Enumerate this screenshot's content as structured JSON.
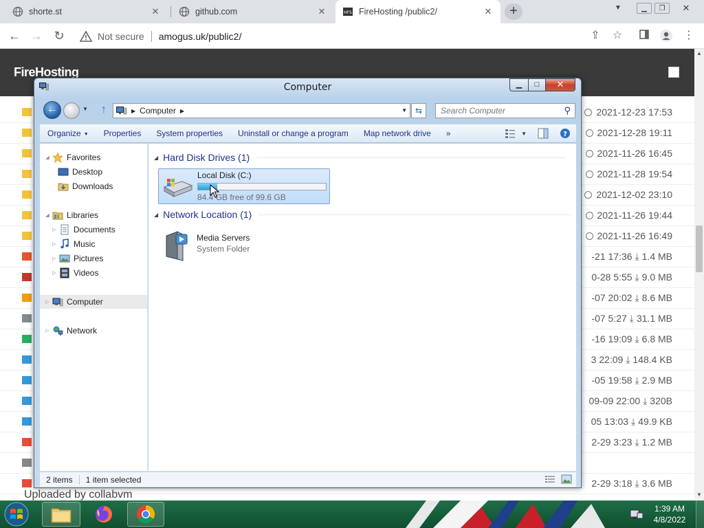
{
  "browser": {
    "tabs": [
      {
        "title": "shorte.st",
        "close": "✕"
      },
      {
        "title": "github.com",
        "close": "✕"
      },
      {
        "title": "FireHosting /public2/",
        "close": "✕"
      }
    ],
    "new_tab": "+",
    "not_secure": "Not secure",
    "url": "amogus.uk/public2/"
  },
  "site": {
    "title": "FireHosting",
    "footer": "Uploaded by collabvm",
    "rows": [
      {
        "meta": "2021-12-23 17:53",
        "kind": "folder"
      },
      {
        "meta": "2021-12-28 19:11",
        "kind": "folder"
      },
      {
        "meta": "2021-11-26 16:45",
        "kind": "folder"
      },
      {
        "meta": "2021-11-28 19:54",
        "kind": "folder"
      },
      {
        "meta": "2021-12-02 23:10",
        "kind": "folder"
      },
      {
        "meta": "2021-11-26 19:44",
        "kind": "folder"
      },
      {
        "meta": "2021-11-26 16:49",
        "kind": "folder"
      },
      {
        "date": "-21 17:36",
        "size": "1.4 MB",
        "kind": "file"
      },
      {
        "date": "0-28 5:55",
        "size": "9.0 MB",
        "kind": "file"
      },
      {
        "date": "-07 20:02",
        "size": "8.6 MB",
        "kind": "file"
      },
      {
        "date": "-07 5:27",
        "size": "31.1 MB",
        "kind": "file"
      },
      {
        "date": "-16 19:09",
        "size": "6.8 MB",
        "kind": "file"
      },
      {
        "date": "3 22:09",
        "size": "148.4 KB",
        "kind": "file"
      },
      {
        "date": "-05 19:58",
        "size": "2.9 MB",
        "kind": "file"
      },
      {
        "date": "09-09 22:00",
        "size": "320B",
        "kind": "file"
      },
      {
        "date": "05 13:03",
        "size": "49.9 KB",
        "kind": "file"
      },
      {
        "date": "2-29 3:23",
        "size": "1.2 MB",
        "kind": "file"
      },
      {
        "date": "",
        "size": "",
        "kind": "blank"
      },
      {
        "date": "2-29 3:18",
        "size": "3.6 MB",
        "kind": "file"
      }
    ]
  },
  "explorer": {
    "title": "Computer",
    "breadcrumb": "Computer",
    "search_placeholder": "Search Computer",
    "commands": [
      "Organize",
      "Properties",
      "System properties",
      "Uninstall or change a program",
      "Map network drive"
    ],
    "more": "»",
    "nav": {
      "favorites": "Favorites",
      "desktop": "Desktop",
      "downloads": "Downloads",
      "libraries": "Libraries",
      "documents": "Documents",
      "music": "Music",
      "pictures": "Pictures",
      "videos": "Videos",
      "computer": "Computer",
      "network": "Network"
    },
    "groups": {
      "hdd": "Hard Disk Drives (1)",
      "net": "Network Location (1)"
    },
    "drive": {
      "name": "Local Disk (C:)",
      "free_text": "84.4 GB free of 99.6 GB",
      "used_fraction": 0.15
    },
    "media": {
      "name": "Media Servers",
      "type": "System Folder"
    },
    "status": {
      "items": "2 items",
      "selected": "1 item selected"
    }
  },
  "taskbar": {
    "time": "1:39 AM",
    "date": "4/8/2022"
  }
}
